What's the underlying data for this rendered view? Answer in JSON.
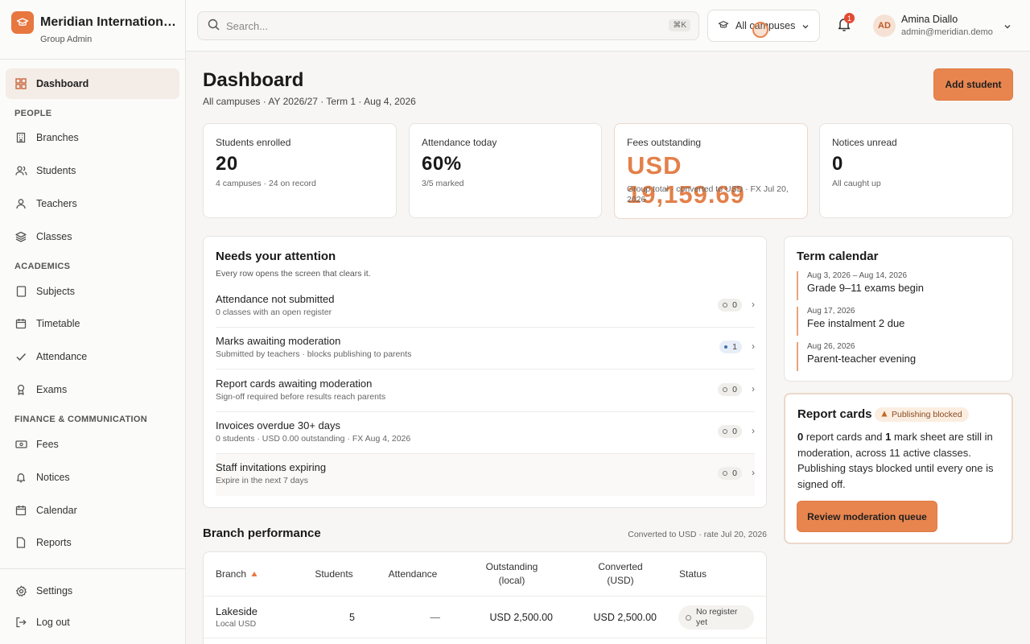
{
  "brand": {
    "name": "Meridian International School Group",
    "role": "Group Admin"
  },
  "nav": {
    "dashboard": "Dashboard",
    "people_header": "PEOPLE",
    "branches": "Branches",
    "students": "Students",
    "teachers": "Teachers",
    "classes": "Classes",
    "academics_header": "ACADEMICS",
    "subjects": "Subjects",
    "timetable": "Timetable",
    "attendance": "Attendance",
    "exams": "Exams",
    "finance_header": "FINANCE & COMMUNICATION",
    "fees": "Fees",
    "notices": "Notices",
    "calendar": "Calendar",
    "reports": "Reports",
    "settings": "Settings",
    "logout": "Log out"
  },
  "topbar": {
    "search_placeholder": "Search...",
    "search_shortcut": "⌘K",
    "campus": "All campuses",
    "notifications_count": "1",
    "user_initials": "AD",
    "user_name": "Amina Diallo",
    "user_email": "admin@meridian.demo"
  },
  "page": {
    "title": "Dashboard",
    "subtitle": "All campuses · AY 2026/27 · Term 1 · Aug 4, 2026",
    "add_student": "Add student"
  },
  "stats": [
    {
      "label": "Students enrolled",
      "value": "20",
      "note": "4 campuses · 24 on record"
    },
    {
      "label": "Attendance today",
      "value": "60%",
      "note": "3/5 marked"
    },
    {
      "label": "Fees outstanding",
      "value": "USD 19,159.69",
      "note": "Group total · converted to USD · FX Jul 20, 2026"
    },
    {
      "label": "Notices unread",
      "value": "0",
      "note": "All caught up"
    }
  ],
  "attention": {
    "title": "Needs your attention",
    "subtitle": "Every row opens the screen that clears it.",
    "rows": [
      {
        "title": "Attendance not submitted",
        "sub": "0 classes with an open register",
        "count": "0"
      },
      {
        "title": "Marks awaiting moderation",
        "sub": "Submitted by teachers · blocks publishing to parents",
        "count": "1"
      },
      {
        "title": "Report cards awaiting moderation",
        "sub": "Sign-off required before results reach parents",
        "count": "0"
      },
      {
        "title": "Invoices overdue 30+ days",
        "sub": "0 students · USD 0.00 outstanding · FX Aug 4, 2026",
        "count": "0"
      },
      {
        "title": "Staff invitations expiring",
        "sub": "Expire in the next 7 days",
        "count": "0"
      }
    ]
  },
  "calendar": {
    "title": "Term calendar",
    "items": [
      {
        "date": "Aug 3, 2026 – Aug 14, 2026",
        "name": "Grade 9–11 exams begin"
      },
      {
        "date": "Aug 17, 2026",
        "name": "Fee instalment 2 due"
      },
      {
        "date": "Aug 26, 2026",
        "name": "Parent-teacher evening"
      }
    ]
  },
  "report_cards": {
    "title": "Report cards",
    "badge": "Publishing blocked",
    "count_cards": "0",
    "text_a": " report cards and ",
    "count_sheets": "1",
    "text_b": " mark sheet are still in moderation, across 11 active classes. Publishing stays blocked until every one is signed off.",
    "button": "Review moderation queue"
  },
  "branch_performance": {
    "title": "Branch performance",
    "note": "Converted to USD · rate Jul 20, 2026",
    "columns": {
      "branch": "Branch",
      "students": "Students",
      "attendance": "Attendance",
      "outstanding_local": "Outstanding (local)",
      "converted": "Converted (USD)",
      "status": "Status"
    },
    "rows": [
      {
        "branch": "Lakeside",
        "currency": "Local USD",
        "students": "5",
        "attendance": "—",
        "outstanding_local": "USD 2,500.00",
        "converted": "USD 2,500.00",
        "status": "No register yet"
      }
    ]
  },
  "colors": {
    "accent": "#e8854f",
    "accent_text": "#e3804a",
    "badge_red": "#e24b32"
  }
}
